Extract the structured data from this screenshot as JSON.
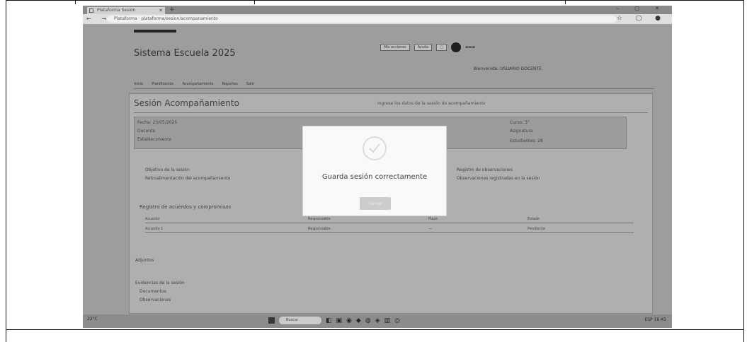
{
  "browser": {
    "tab_title": "Plataforma Sesión",
    "url": "Plataforma · plataforma/sesion/acompanamiento",
    "nav_glyphs": "← → ⟳",
    "addr_icons": "☆ ▢ ●",
    "window_controls": "– ▢ ✕"
  },
  "app": {
    "brand": "Sistema Escuela 2025",
    "header_buttons": [
      "Mis acciones",
      "Ayuda"
    ],
    "user_text": "Bienvenido: USUARIO DOCENTE",
    "menu": [
      "Inicio",
      "Planificación",
      "Acompañamiento",
      "Reportes",
      "Salir"
    ]
  },
  "sesion": {
    "title": "Sesión Acompañamiento",
    "subtitle": "Ingrese los datos de la sesión de acompañamiento",
    "info_left": [
      "Fecha: 23/05/2025",
      "Docente",
      "Establecimiento"
    ],
    "info_right": [
      "Curso: 3°",
      "Asignatura",
      "Estudiantes: 28"
    ],
    "section_left": [
      "Objetivo de la sesión",
      "Retroalimentación del acompañamiento"
    ],
    "section_right": [
      "Registro de observaciones",
      "Observaciones registradas en la sesión"
    ],
    "table_caption": "Registro de acuerdos y compromisos",
    "table_headers": [
      "Acuerdo",
      "Responsable",
      "Plazo",
      "Estado"
    ],
    "table_row": [
      "Acuerdo 1",
      "Responsable",
      "—",
      "Pendiente"
    ],
    "footer_items": [
      "Adjuntos",
      "Evidencias de la sesión",
      "Documentos",
      "Observaciones"
    ]
  },
  "modal": {
    "icon": "check-icon",
    "message": "Guarda sesión correctamente",
    "button_label": "Cerrar"
  },
  "taskbar": {
    "weather": "22°C",
    "search_placeholder": "Buscar",
    "icons": [
      "◧",
      "▣",
      "◉",
      "◆",
      "◍",
      "◈",
      "▥",
      "◎"
    ],
    "tray": "ESP 16:45"
  },
  "colors": {
    "modal_bg": "#ffffff",
    "button_bg": "#d0d0d0",
    "page_bg": "#a9a9a9"
  }
}
